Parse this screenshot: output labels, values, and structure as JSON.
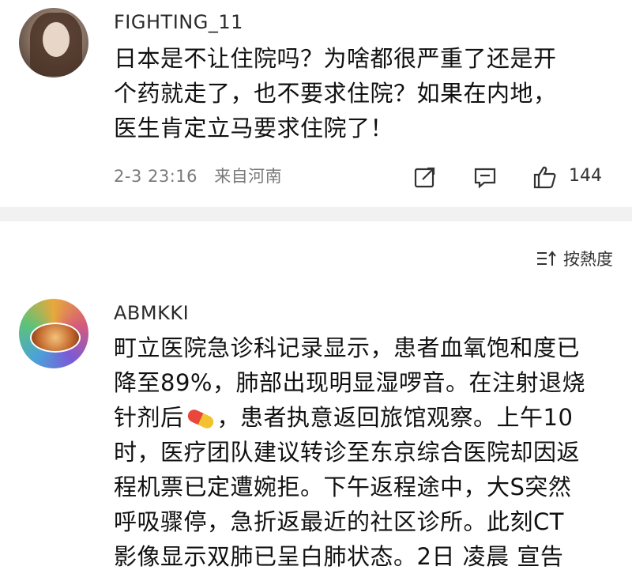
{
  "comments": [
    {
      "username": "FIGHTING_11",
      "lines": [
        "日本是不让住院吗？为啥都很严重了还是开",
        "个药就走了，也不要求住院？如果在内地，",
        "医生肯定立马要求住院了！"
      ],
      "date": "2-3 23:16",
      "location": "来自河南",
      "likes": "144"
    },
    {
      "username": "ABMKKI",
      "lines": [
        "町立医院急诊科记录显示，患者血氧饱和度已",
        "降至89%，肺部出现明显湿啰音。在注射退烧",
        "针剂后",
        "，患者执意返回旅馆观察。上午10",
        "时，医疗团队建议转诊至东京综合医院却因返",
        "程机票已定遭婉拒。下午返程途中，大S突然",
        "呼吸骤停，急折返最近的社区诊所。此刻CT",
        "影像显示双肺已呈白肺状态。2日 凌晨 宣告"
      ]
    }
  ],
  "sort_label": "按熱度",
  "icons": {
    "share": "share-icon",
    "reply": "reply-icon",
    "like": "thumbs-up-icon",
    "sort": "sort-icon",
    "pill_emoji": "pill-icon"
  }
}
